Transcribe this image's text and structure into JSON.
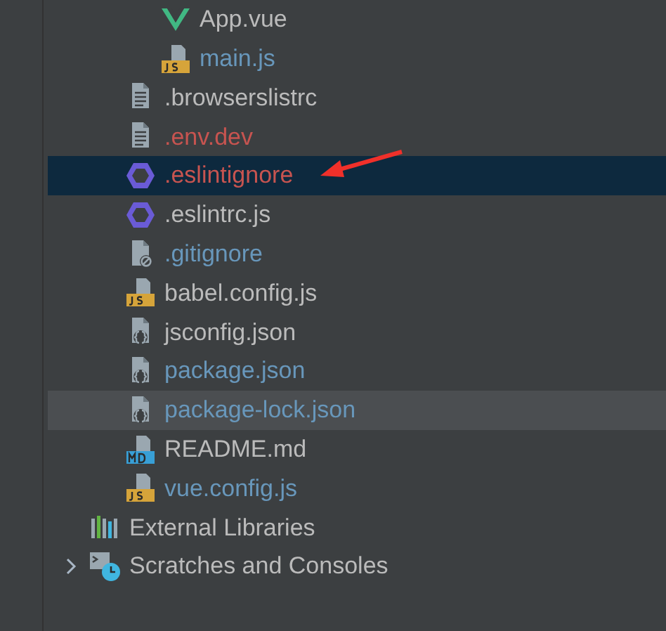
{
  "tree": [
    {
      "children": [
        {
          "children": [
            {
              "name": "App.vue",
              "kind": "vue",
              "color": "#bbbbbb",
              "selected": false,
              "hovered": false
            },
            {
              "name": "main.js",
              "kind": "js",
              "color": "#6897bb",
              "selected": false,
              "hovered": false
            }
          ]
        },
        {
          "name": ".browserslistrc",
          "kind": "text",
          "color": "#bbbbbb",
          "selected": false,
          "hovered": false
        },
        {
          "name": ".env.dev",
          "kind": "text",
          "color": "#c75450",
          "selected": false,
          "hovered": false
        },
        {
          "name": ".eslintignore",
          "kind": "eslint",
          "color": "#c75450",
          "selected": true,
          "hovered": false
        },
        {
          "name": ".eslintrc.js",
          "kind": "eslint",
          "color": "#bbbbbb",
          "selected": false,
          "hovered": false
        },
        {
          "name": ".gitignore",
          "kind": "ignore",
          "color": "#6897bb",
          "selected": false,
          "hovered": false
        },
        {
          "name": "babel.config.js",
          "kind": "js",
          "color": "#bbbbbb",
          "selected": false,
          "hovered": false
        },
        {
          "name": "jsconfig.json",
          "kind": "json",
          "color": "#bbbbbb",
          "selected": false,
          "hovered": false
        },
        {
          "name": "package.json",
          "kind": "json",
          "color": "#6897bb",
          "selected": false,
          "hovered": false
        },
        {
          "name": "package-lock.json",
          "kind": "json",
          "color": "#6897bb",
          "selected": false,
          "hovered": true
        },
        {
          "name": "README.md",
          "kind": "md",
          "color": "#bbbbbb",
          "selected": false,
          "hovered": false
        },
        {
          "name": "vue.config.js",
          "kind": "js",
          "color": "#6897bb",
          "selected": false,
          "hovered": false
        }
      ]
    },
    {
      "name": "External Libraries",
      "kind": "libraries",
      "color": "#bbbbbb",
      "selected": false,
      "hovered": false
    },
    {
      "name": "Scratches and Consoles",
      "kind": "scratches",
      "color": "#bbbbbb",
      "selected": false,
      "hovered": false,
      "expanded": false
    }
  ]
}
